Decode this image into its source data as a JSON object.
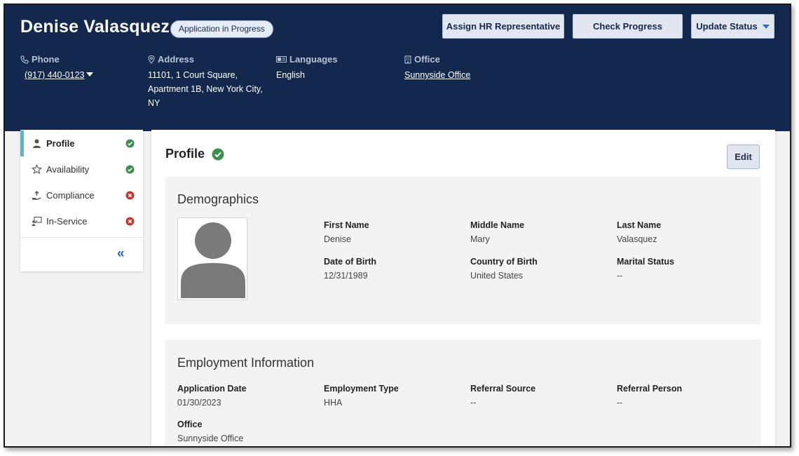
{
  "header": {
    "name": "Denise Valasquez",
    "status_badge": "Application in Progress",
    "buttons": {
      "assign_hr": "Assign HR Representative",
      "check_progress": "Check Progress",
      "update_status": "Update Status"
    },
    "phone": {
      "label": "Phone",
      "value": "(917) 440-0123"
    },
    "address": {
      "label": "Address",
      "line1": "11101, 1 Court Square,",
      "line2": "Apartment 1B, New York City,",
      "line3": "NY"
    },
    "languages": {
      "label": "Languages",
      "value": "English"
    },
    "office": {
      "label": "Office",
      "value": "Sunnyside Office"
    }
  },
  "sidebar": {
    "items": [
      {
        "label": "Profile",
        "icon": "person-icon",
        "status": "complete"
      },
      {
        "label": "Availability",
        "icon": "star-icon",
        "status": "complete"
      },
      {
        "label": "Compliance",
        "icon": "hand-icon",
        "status": "incomplete"
      },
      {
        "label": "In-Service",
        "icon": "training-icon",
        "status": "incomplete"
      }
    ],
    "collapse_glyph": "«"
  },
  "main": {
    "title": "Profile",
    "edit_label": "Edit",
    "demographics": {
      "title": "Demographics",
      "first_name": {
        "label": "First Name",
        "value": "Denise"
      },
      "middle_name": {
        "label": "Middle Name",
        "value": "Mary"
      },
      "last_name": {
        "label": "Last Name",
        "value": "Valasquez"
      },
      "dob": {
        "label": "Date of Birth",
        "value": "12/31/1989"
      },
      "country": {
        "label": "Country of Birth",
        "value": "United States"
      },
      "marital": {
        "label": "Marital Status",
        "value": "--"
      }
    },
    "employment": {
      "title": "Employment Information",
      "application_date": {
        "label": "Application Date",
        "value": "01/30/2023"
      },
      "employment_type": {
        "label": "Employment Type",
        "value": "HHA"
      },
      "referral_source": {
        "label": "Referral Source",
        "value": "--"
      },
      "referral_person": {
        "label": "Referral Person",
        "value": "--"
      },
      "office": {
        "label": "Office",
        "value": "Sunnyside Office"
      }
    }
  },
  "colors": {
    "header_bg": "#13284d",
    "accent": "#61b3c9",
    "success": "#3e8e4f",
    "danger": "#c0392b",
    "link_blue": "#2f5fbf"
  }
}
